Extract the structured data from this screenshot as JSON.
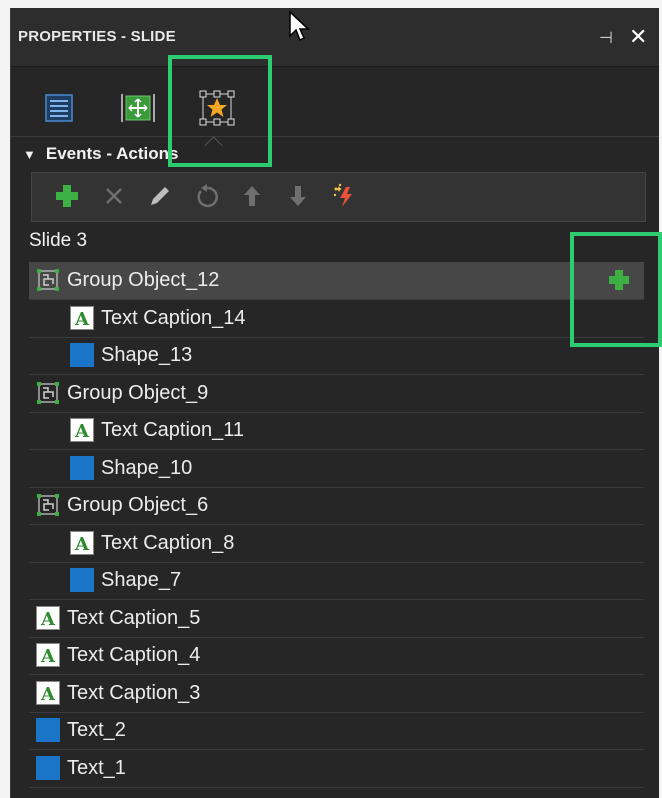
{
  "panel": {
    "title": "PROPERTIES - SLIDE",
    "pin_icon": "pin-icon",
    "close_icon": "close-icon"
  },
  "tabs": [
    {
      "name": "properties-tab",
      "icon": "list-icon"
    },
    {
      "name": "timing-tab",
      "icon": "move-icon"
    },
    {
      "name": "actions-tab",
      "icon": "star-icon",
      "active": true
    }
  ],
  "section": {
    "title": "Events - Actions"
  },
  "toolbar": {
    "buttons": [
      "add-icon",
      "delete-icon",
      "edit-icon",
      "undo-icon",
      "move-up-icon",
      "move-down-icon",
      "effects-icon"
    ]
  },
  "tree": {
    "slide_label": "Slide 3",
    "items": [
      {
        "label": "Group Object_12",
        "type": "group",
        "indent": 0,
        "selected": true
      },
      {
        "label": "Text Caption_14",
        "type": "text",
        "indent": 1
      },
      {
        "label": "Shape_13",
        "type": "shape",
        "indent": 1
      },
      {
        "label": "Group Object_9",
        "type": "group",
        "indent": 0
      },
      {
        "label": "Text Caption_11",
        "type": "text",
        "indent": 1
      },
      {
        "label": "Shape_10",
        "type": "shape",
        "indent": 1
      },
      {
        "label": "Group Object_6",
        "type": "group",
        "indent": 0
      },
      {
        "label": "Text Caption_8",
        "type": "text",
        "indent": 1
      },
      {
        "label": "Shape_7",
        "type": "shape",
        "indent": 1
      },
      {
        "label": "Text Caption_5",
        "type": "text",
        "indent": 0
      },
      {
        "label": "Text Caption_4",
        "type": "text",
        "indent": 0
      },
      {
        "label": "Text Caption_3",
        "type": "text",
        "indent": 0
      },
      {
        "label": "Text_2",
        "type": "shape",
        "indent": 0
      },
      {
        "label": "Text_1",
        "type": "shape",
        "indent": 0
      }
    ]
  },
  "colors": {
    "panel_bg": "#262626",
    "highlight": "#2ecc71",
    "add_green": "#3cb043",
    "shape_blue": "#1a74c8",
    "star_orange": "#f5a623"
  }
}
